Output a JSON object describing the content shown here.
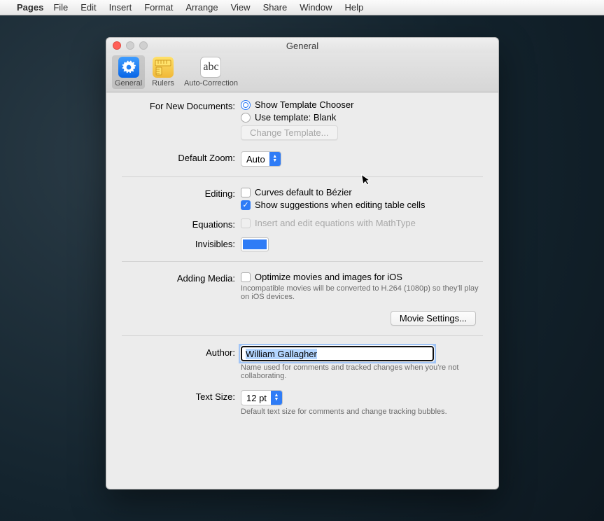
{
  "menubar": {
    "app": "Pages",
    "items": [
      "File",
      "Edit",
      "Insert",
      "Format",
      "Arrange",
      "View",
      "Share",
      "Window",
      "Help"
    ]
  },
  "window": {
    "title": "General",
    "toolbar": {
      "general": "General",
      "rulers": "Rulers",
      "autocorrection": "Auto-Correction"
    }
  },
  "labels": {
    "forNew": "For New Documents:",
    "defaultZoom": "Default Zoom:",
    "editing": "Editing:",
    "equations": "Equations:",
    "invisibles": "Invisibles:",
    "addingMedia": "Adding Media:",
    "author": "Author:",
    "textSize": "Text Size:"
  },
  "forNew": {
    "showChooser": "Show Template Chooser",
    "useTemplate": "Use template: Blank",
    "changeBtn": "Change Template..."
  },
  "zoom": {
    "value": "Auto"
  },
  "editing": {
    "bezier": "Curves default to Bézier",
    "suggestions": "Show suggestions when editing table cells"
  },
  "equations": {
    "mathtype": "Insert and edit equations with MathType"
  },
  "media": {
    "optimize": "Optimize movies and images for iOS",
    "hint": "Incompatible movies will be converted to H.264 (1080p) so they'll play on iOS devices.",
    "movieBtn": "Movie Settings..."
  },
  "author": {
    "value": "William Gallagher",
    "hint": "Name used for comments and tracked changes when you're not collaborating."
  },
  "textSize": {
    "value": "12 pt",
    "hint": "Default text size for comments and change tracking bubbles."
  },
  "invisiblesColor": "#2f7cf6",
  "abc": "abc"
}
